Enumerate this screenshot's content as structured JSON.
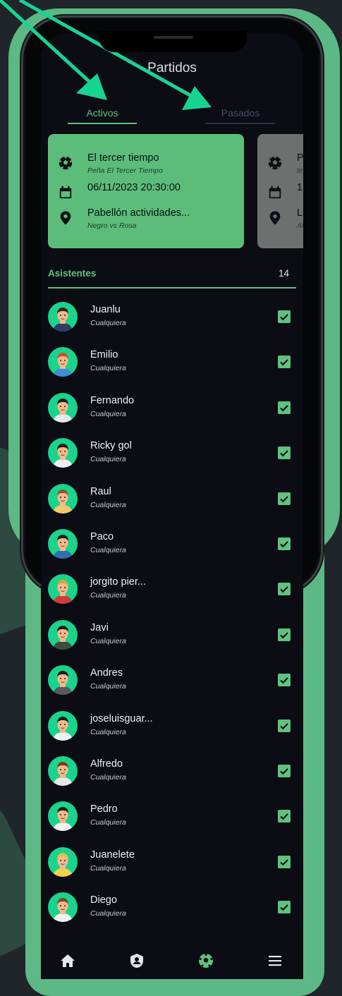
{
  "header": {
    "title": "Partidos"
  },
  "tabs": [
    {
      "label": "Activos"
    },
    {
      "label": "Pasados"
    }
  ],
  "cards": [
    {
      "name": "El tercer tiempo",
      "group": "Peña El Tercer Tiempo",
      "datetime": "06/11/2023 20:30:00",
      "place": "Pabellón actividades...",
      "teams": "Negro vs Rosa"
    },
    {
      "name": "P",
      "group": "te",
      "datetime": "1",
      "place": "L",
      "teams": "Al"
    }
  ],
  "attendees": {
    "label": "Asistentes",
    "count": "14",
    "list": [
      {
        "name": "Juanlu",
        "role": "Cualquiera"
      },
      {
        "name": "Emilio",
        "role": "Cualquiera"
      },
      {
        "name": "Fernando",
        "role": "Cualquiera"
      },
      {
        "name": "Ricky gol",
        "role": "Cualquiera"
      },
      {
        "name": "Raul",
        "role": "Cualquiera"
      },
      {
        "name": "Paco",
        "role": "Cualquiera"
      },
      {
        "name": "jorgito  pier...",
        "role": "Cualquiera"
      },
      {
        "name": "Javi",
        "role": "Cualquiera"
      },
      {
        "name": "Andres",
        "role": "Cualquiera"
      },
      {
        "name": "joseluisguar...",
        "role": "Cualquiera"
      },
      {
        "name": "Alfredo",
        "role": "Cualquiera"
      },
      {
        "name": "Pedro",
        "role": "Cualquiera"
      },
      {
        "name": "Juanelete",
        "role": "Cualquiera"
      },
      {
        "name": "Diego",
        "role": "Cualquiera"
      }
    ]
  },
  "nav": [
    "home-icon",
    "user-badge-icon",
    "soccer-ball-icon",
    "menu-icon"
  ],
  "colors": {
    "accent": "#5fc27e",
    "background": "#0b0c14",
    "frame": "#5cb884"
  }
}
